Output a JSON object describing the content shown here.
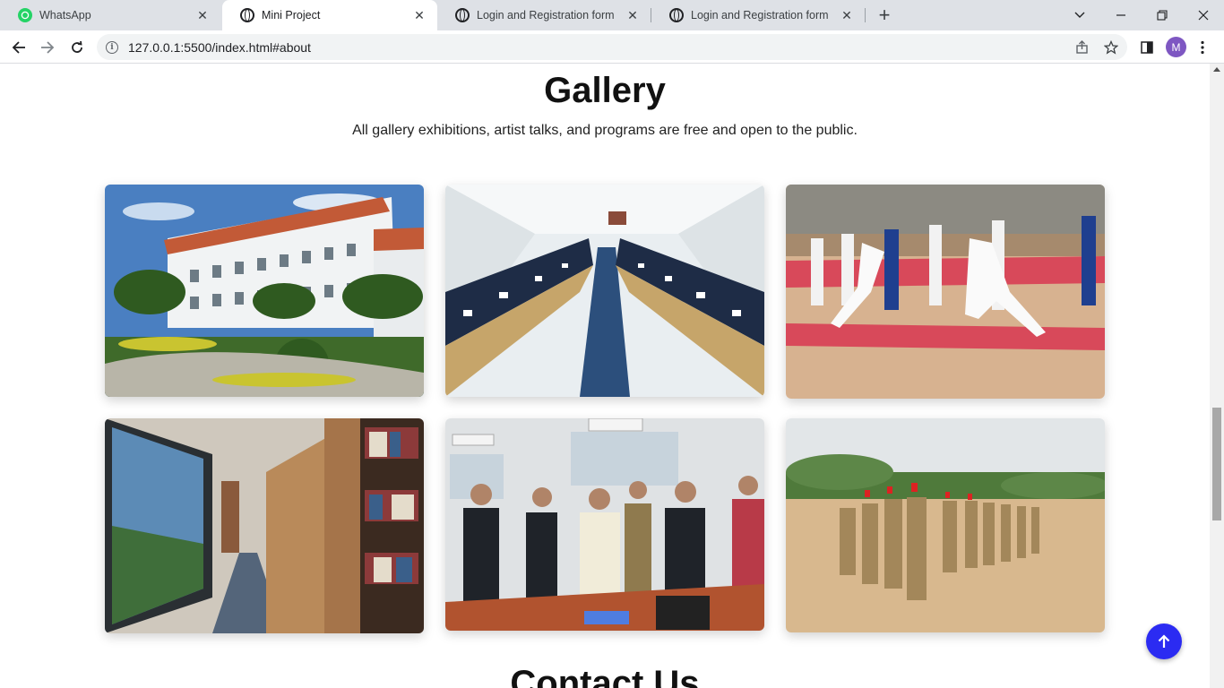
{
  "browser": {
    "tabs": [
      {
        "title": "WhatsApp",
        "icon": "whatsapp-icon",
        "active": false
      },
      {
        "title": "Mini Project",
        "icon": "globe-icon",
        "active": true
      },
      {
        "title": "Login and Registration form",
        "icon": "globe-icon",
        "active": false
      },
      {
        "title": "Login and Registration form",
        "icon": "globe-icon",
        "active": false
      }
    ],
    "url": "127.0.0.1:5500/index.html#about",
    "profile_initial": "M"
  },
  "gallery": {
    "title": "Gallery",
    "subtitle": "All gallery exhibitions, artist talks, and programs are free and open to the public.",
    "images": [
      {
        "subject": "campus building"
      },
      {
        "subject": "computer lab"
      },
      {
        "subject": "fencing match"
      },
      {
        "subject": "library aisle"
      },
      {
        "subject": "lab inauguration"
      },
      {
        "subject": "cadet parade"
      }
    ]
  },
  "contact": {
    "title": "Contact Us"
  },
  "colors": {
    "accent": "#2b2bf2"
  }
}
